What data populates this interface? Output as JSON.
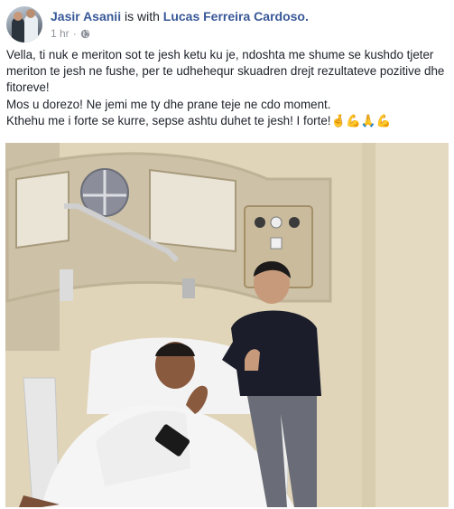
{
  "post": {
    "author": "Jasir Asanii",
    "with_text": "is with",
    "tagged": "Lucas Ferreira Cardoso.",
    "time": "1 hr",
    "separator": "·",
    "audience_icon": "globe-icon",
    "paragraphs": [
      "Vella, ti nuk e meriton sot te jesh ketu ku je, ndoshta me shume se kushdo tjeter meriton te jesh ne fushe, per te udhehequr skuadren drejt rezultateve pozitive dhe fitoreve!",
      "Mos u dorezo! Ne jemi me ty dhe prane teje ne cdo moment.",
      "Kthehu me i forte se kurre, sepse ashtu duhet te jesh! I forte!"
    ],
    "emojis": "🤞💪🙏💪"
  },
  "colors": {
    "link": "#385898",
    "text": "#1d2129",
    "meta": "#90949c"
  }
}
